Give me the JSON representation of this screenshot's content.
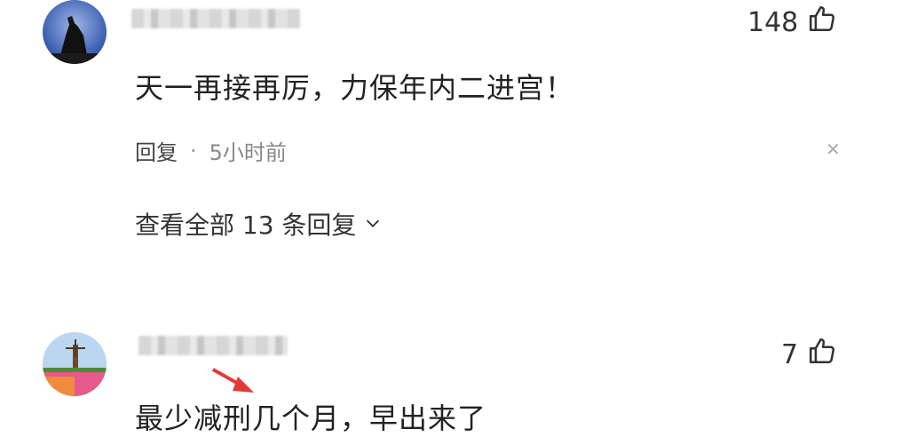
{
  "comments": [
    {
      "likes": "148",
      "text": "天一再接再厉，力保年内二进宫！",
      "reply_label": "回复",
      "time": "5小时前",
      "view_all": "查看全部 13 条回复"
    },
    {
      "likes": "7",
      "text": "最少减刑几个月，早出来了"
    }
  ],
  "icons": {
    "like": "thumbs-up-icon",
    "close": "close-icon",
    "chevron": "chevron-down-icon"
  },
  "colors": {
    "annotation_arrow": "#e53935"
  }
}
